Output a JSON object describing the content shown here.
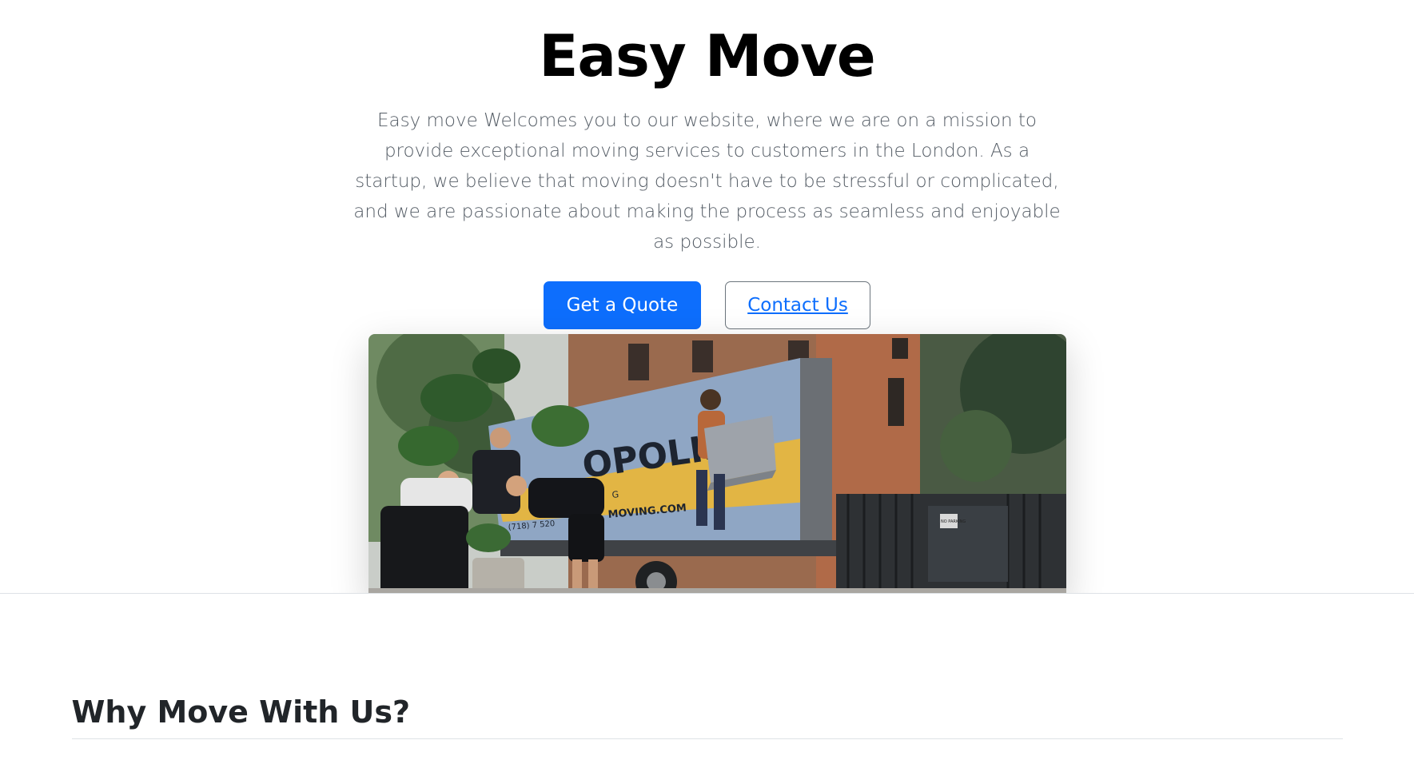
{
  "hero": {
    "title": "Easy Move",
    "lead": "Easy move Welcomes you to our website, where we are on a mission to provide exceptional moving services to customers in the London. As a startup, we believe that moving doesn't have to be stressful or complicated, and we are passionate about making the process as seamless and enjoyable as possible.",
    "primary_button": "Get a Quote",
    "secondary_button": "Contact Us",
    "image": {
      "truck_text": "OPOLIS",
      "truck_url": "MOVING.COM",
      "truck_sub": "G",
      "truck_phone": "(718) 7 520",
      "sign_text": "NO PARKING"
    }
  },
  "features": {
    "title": "Why Move With Us?"
  },
  "colors": {
    "primary": "#0d6efd",
    "text_dark": "#212529",
    "text_muted": "#555d66",
    "border": "#dee2e6"
  }
}
